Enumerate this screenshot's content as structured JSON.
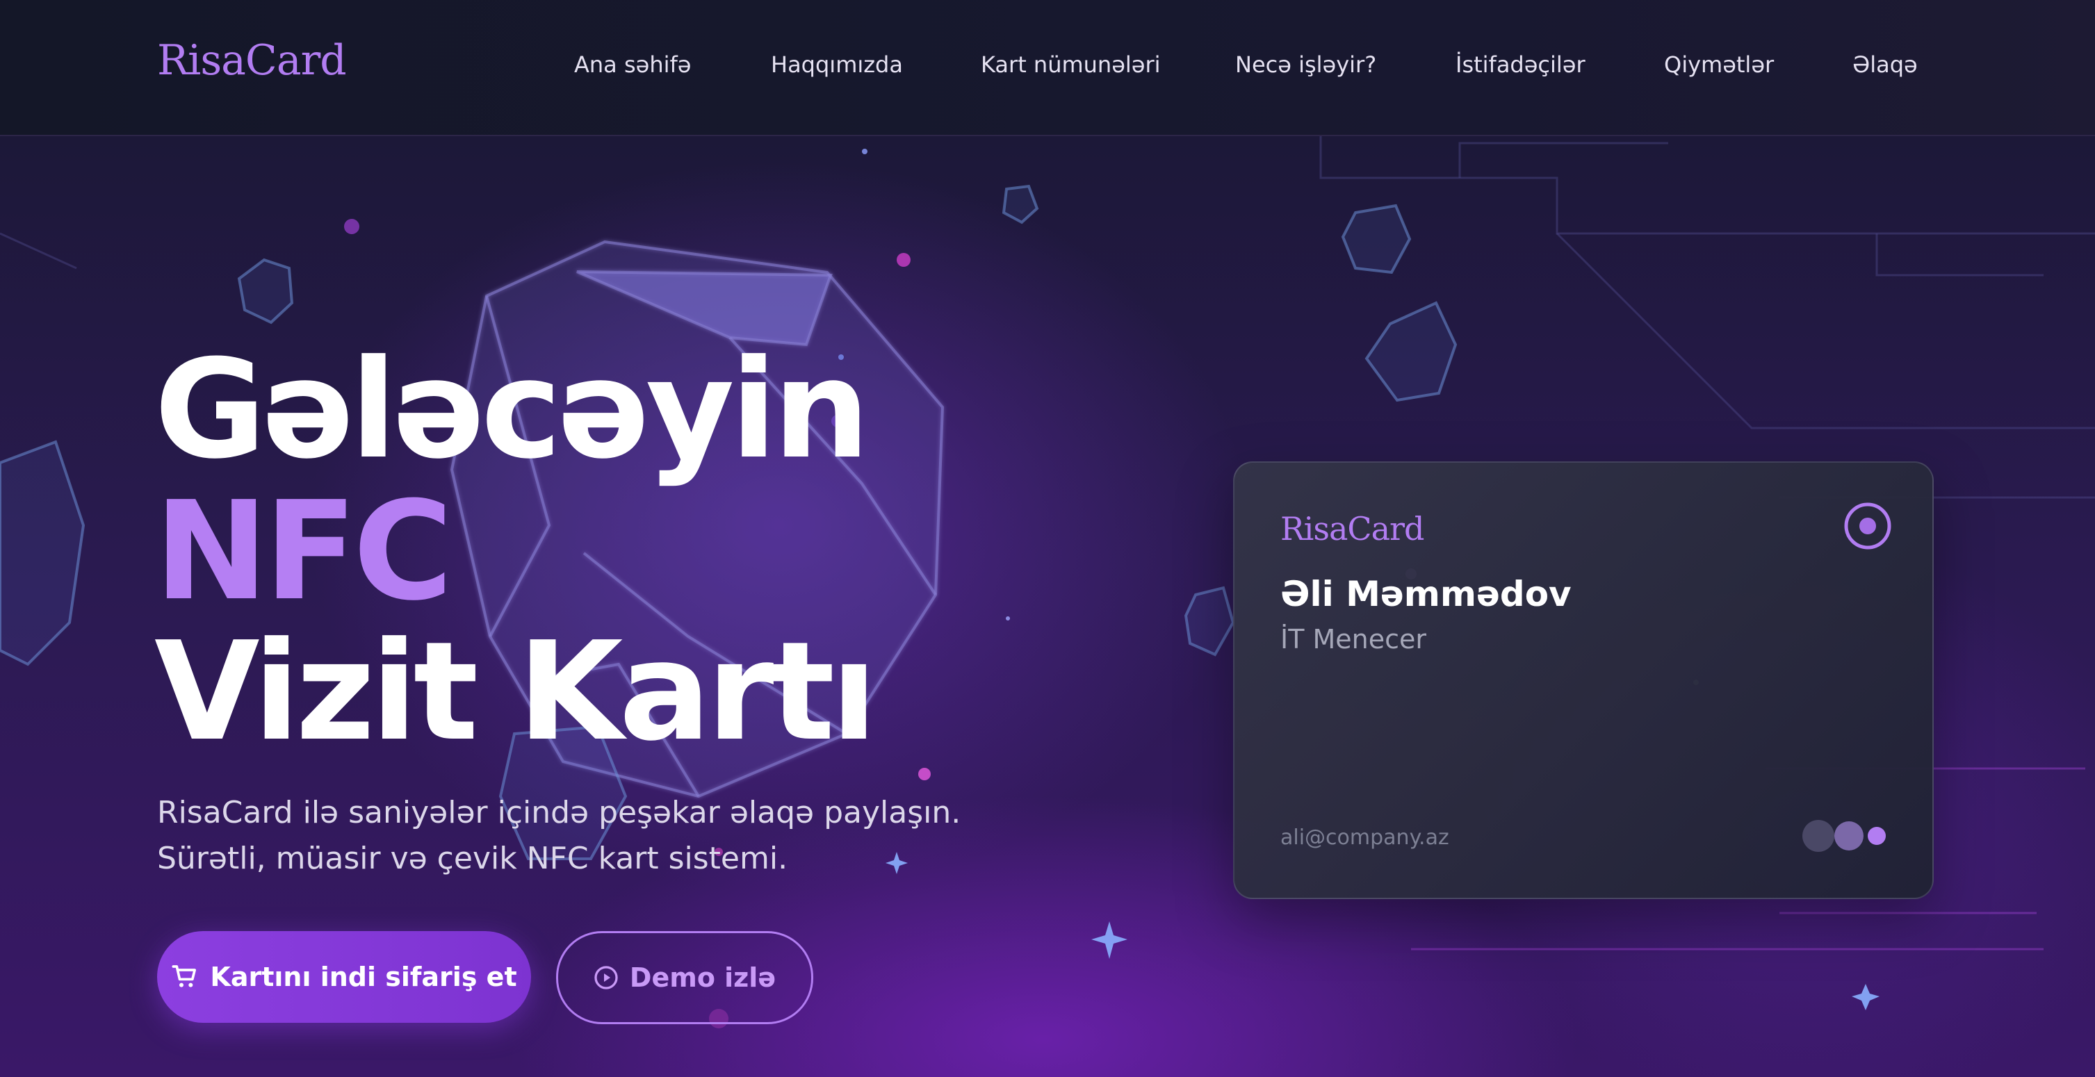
{
  "header": {
    "logo": "RisaCard",
    "nav": [
      "Ana səhifə",
      "Haqqımızda",
      "Kart nümunələri",
      "Necə işləyir?",
      "İstifadəçilər",
      "Qiymətlər",
      "Əlaqə"
    ]
  },
  "hero": {
    "headline": [
      "Gələcəyin",
      "NFC",
      "Vizit Kartı"
    ],
    "subtitle": [
      "RisaCard ilə saniyələr içində peşəkar əlaqə paylaşın.",
      "Sürətli, müasir və çevik NFC kart sistemi."
    ],
    "primary_button": {
      "label": "Kartını indi sifariş et",
      "icon": "cart-icon"
    },
    "secondary_button": {
      "label": "Demo izlə",
      "icon": "play-circle-icon"
    }
  },
  "card": {
    "logo": "RisaCard",
    "name": "Əli Məmmədov",
    "role": "İT Menecer",
    "email": "ali@company.az",
    "icon": "nfc-target-icon"
  },
  "colors": {
    "accent": "#b27df2",
    "button": "#8c3fe0",
    "background": "#141427",
    "hero_glow": "#6a2ab8"
  }
}
